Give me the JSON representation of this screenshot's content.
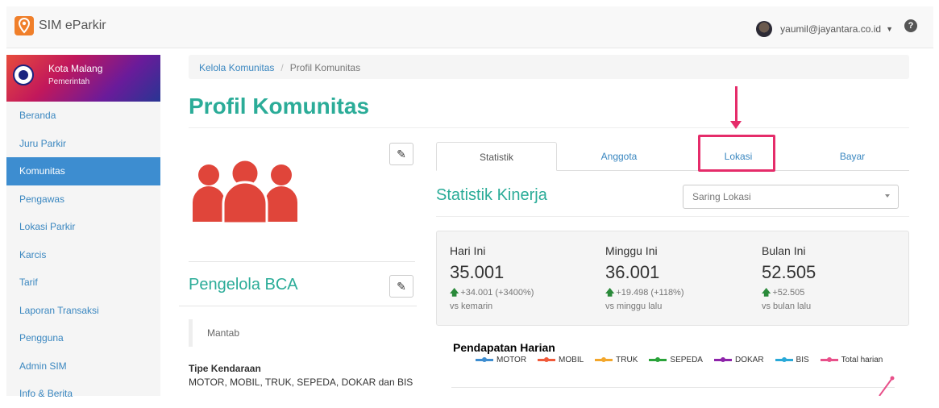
{
  "app": {
    "title": "SIM eParkir"
  },
  "user": {
    "email": "yaumil@jayantara.co.id"
  },
  "org": {
    "name": "Kota Malang",
    "type": "Pemerintah"
  },
  "sidebar": {
    "items": [
      {
        "label": "Beranda"
      },
      {
        "label": "Juru Parkir"
      },
      {
        "label": "Komunitas"
      },
      {
        "label": "Pengawas"
      },
      {
        "label": "Lokasi Parkir"
      },
      {
        "label": "Karcis"
      },
      {
        "label": "Tarif"
      },
      {
        "label": "Laporan Transaksi"
      },
      {
        "label": "Pengguna"
      },
      {
        "label": "Admin SIM"
      },
      {
        "label": "Info & Berita"
      }
    ]
  },
  "breadcrumb": {
    "parent": "Kelola Komunitas",
    "current": "Profil Komunitas"
  },
  "page": {
    "title": "Profil Komunitas"
  },
  "community": {
    "name": "Pengelola BCA",
    "description": "Mantab",
    "vehicle_label": "Tipe Kendaraan",
    "vehicle_value": "MOTOR, MOBIL, TRUK, SEPEDA, DOKAR dan BIS"
  },
  "tabs": [
    {
      "label": "Statistik"
    },
    {
      "label": "Anggota"
    },
    {
      "label": "Lokasi"
    },
    {
      "label": "Bayar"
    }
  ],
  "stats": {
    "title": "Statistik Kinerja",
    "filter_placeholder": "Saring Lokasi",
    "kpis": [
      {
        "label": "Hari Ini",
        "value": "35.001",
        "delta": "+34.001 (+3400%)",
        "compare": "vs kemarin"
      },
      {
        "label": "Minggu Ini",
        "value": "36.001",
        "delta": "+19.498 (+118%)",
        "compare": "vs minggu lalu"
      },
      {
        "label": "Bulan Ini",
        "value": "52.505",
        "delta": "+52.505",
        "compare": "vs bulan lalu"
      }
    ]
  },
  "chart": {
    "title": "Pendapatan Harian",
    "legend": [
      {
        "name": "MOTOR",
        "color": "#3d8dd0"
      },
      {
        "name": "MOBIL",
        "color": "#f05a3a"
      },
      {
        "name": "TRUK",
        "color": "#f3a72c"
      },
      {
        "name": "SEPEDA",
        "color": "#2aa33a"
      },
      {
        "name": "DOKAR",
        "color": "#8e24aa"
      },
      {
        "name": "BIS",
        "color": "#29a9d8"
      },
      {
        "name": "Total harian",
        "color": "#e8508a"
      }
    ]
  },
  "colors": {
    "accent": "#2bac98",
    "active_menu": "#3d8dd0",
    "highlight": "#e52c6a",
    "icon": "#e0453a"
  }
}
